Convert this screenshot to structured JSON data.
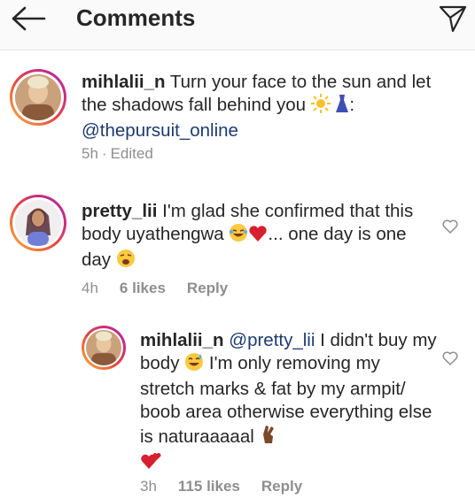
{
  "header": {
    "title": "Comments",
    "back_icon": "arrow-left-icon",
    "share_icon": "paper-plane-icon"
  },
  "caption": {
    "username": "mihlalii_n",
    "text_part1": "Turn your face to the sun and let the shadows fall behind you",
    "text_part2": ":",
    "mention": "@thepursuit_online",
    "time": "5h",
    "separator": "·",
    "edited": "Edited"
  },
  "comments": [
    {
      "username": "pretty_lii",
      "text_part1": "I'm glad she confirmed that this body uyathengwa",
      "text_part2": "... one day is one day",
      "time": "4h",
      "likes": "6 likes",
      "reply_label": "Reply"
    },
    {
      "username": "mihlalii_n",
      "mention": "@pretty_lii",
      "text_part1": "I didn't buy my body",
      "text_part2": "I'm only removing my stretch marks & fat by my armpit/ boob area otherwise everything else is naturaaaaal",
      "time": "3h",
      "likes": "115 likes",
      "reply_label": "Reply"
    }
  ],
  "colors": {
    "accent_ring": "#e8473f",
    "text": "#262626",
    "muted": "#8e8e8e",
    "mention": "#1d3a6f"
  }
}
